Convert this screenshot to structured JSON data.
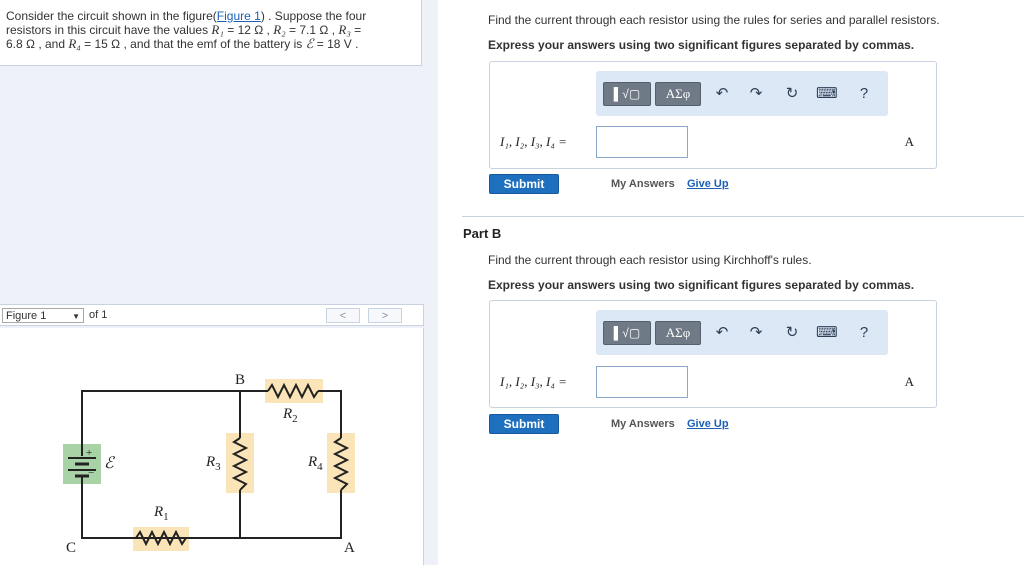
{
  "problem": {
    "p1": "Consider the circuit shown in the figure(",
    "fig_link": "Figure 1",
    "p2": ") . Suppose the four",
    "p3": "resistors in this circuit have the values ",
    "r1_sym": "R₁",
    "r1_val": " = 12 Ω , ",
    "r2_sym": "R₂",
    "r2_val": " = 7.1 Ω , ",
    "r3_sym": "R₃",
    "r3_val": " =",
    "p4": "6.8 Ω , and ",
    "r4_sym": "R₄",
    "r4_val": " = 15 Ω , and that the emf of the battery is ",
    "emf_sym": "ℰ",
    "emf_val": " = 18 V ."
  },
  "figure_bar": {
    "select_value": "Figure 1",
    "of_text": "of 1",
    "prev": "<",
    "next": ">"
  },
  "figure": {
    "label_B": "B",
    "label_C": "C",
    "label_A": "A",
    "label_plus": "+",
    "label_minus": "−",
    "label_emf": "ℰ",
    "R1": "R",
    "R1_sub": "1",
    "R2": "R",
    "R2_sub": "2",
    "R3": "R",
    "R3_sub": "3",
    "R4": "R",
    "R4_sub": "4"
  },
  "partA": {
    "instruction": "Find the current through each resistor using the rules for series and parallel resistors.",
    "express": "Express your answers using two significant figures separated by commas.",
    "toolbar_btn1": "▌√▢",
    "toolbar_btn2": "ΑΣφ",
    "help": "?",
    "label": "I₁, I₂, I₃, I₄ =",
    "input_value": "",
    "unit": "A",
    "submit": "Submit",
    "my_answers": "My Answers",
    "give_up": "Give Up"
  },
  "partB": {
    "title": "Part B",
    "instruction": "Find the current through each resistor using Kirchhoff's rules.",
    "express": "Express your answers using two significant figures separated by commas.",
    "toolbar_btn1": "▌√▢",
    "toolbar_btn2": "ΑΣφ",
    "help": "?",
    "label": "I₁, I₂, I₃, I₄ =",
    "input_value": "",
    "unit": "A",
    "submit": "Submit",
    "my_answers": "My Answers",
    "give_up": "Give Up"
  },
  "icons": {
    "undo": "undo-icon",
    "redo": "redo-icon",
    "reset": "reset-icon",
    "keyboard": "keyboard-icon"
  },
  "colors": {
    "accent": "#1e6fbe",
    "link": "#1b61b8",
    "toolbar_bg": "#dce8f6",
    "resistor_highlight": "#fbe5b8",
    "battery_highlight": "#a9d2a6"
  }
}
